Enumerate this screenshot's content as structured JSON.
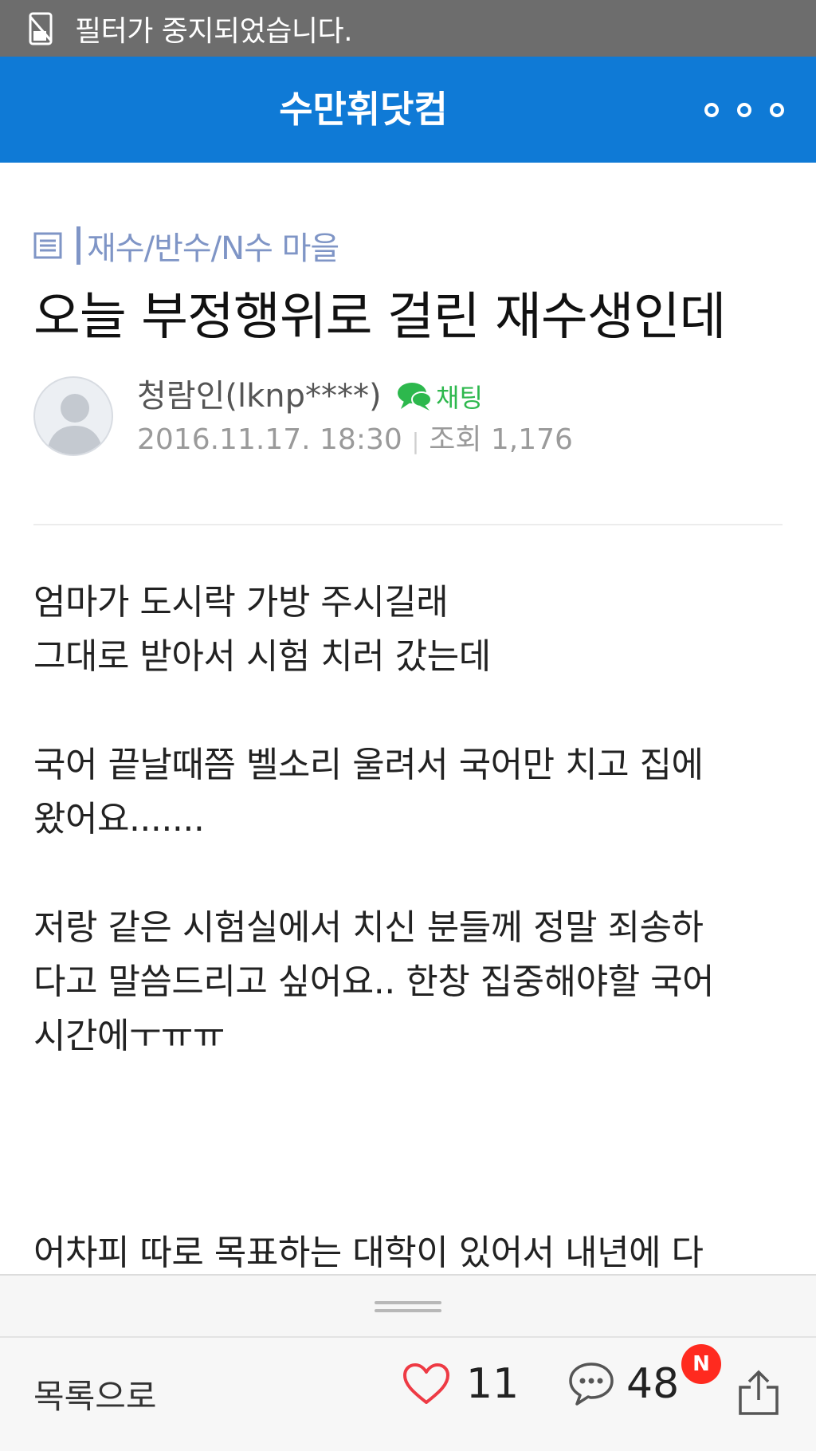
{
  "status_bar": {
    "text": "필터가 중지되었습니다."
  },
  "header": {
    "title": "수만휘닷컴"
  },
  "post": {
    "category": "재수/반수/N수 마을",
    "title": "오늘 부정행위로 걸린 재수생인데",
    "author": "청람인(lknp****)",
    "chat_label": "채팅",
    "date": "2016.11.17. 18:30",
    "views_label": "조회 1,176",
    "body": [
      [
        "엄마가 도시락 가방 주시길래",
        "그대로 받아서 시험 치러 갔는데"
      ],
      [
        "국어 끝날때쯤 벨소리 울려서 국어만 치고 집에",
        "왔어요......."
      ],
      [
        "저랑 같은 시험실에서 치신 분들께 정말 죄송하",
        "다고 말씀드리고 싶어요.. 한창 집중해야할 국어",
        "시간에ㅜㅠㅠ"
      ],
      [
        "어차피 따로 목표하는 대학이 있어서 내년에 다"
      ]
    ]
  },
  "bottom_bar": {
    "back_label": "목록으로",
    "likes": "11",
    "comments": "48",
    "new_badge": "N"
  },
  "colors": {
    "header_bg": "#0f7ad6",
    "status_bg": "#6d6d6d",
    "category": "#7f95c6",
    "chat_green": "#2db84d",
    "heart": "#ee3a44",
    "badge": "#ff2a1f"
  },
  "icons": [
    "filter-icon",
    "more-icon",
    "board-icon",
    "avatar",
    "chat-icon",
    "heart-icon",
    "comment-icon",
    "share-icon"
  ]
}
